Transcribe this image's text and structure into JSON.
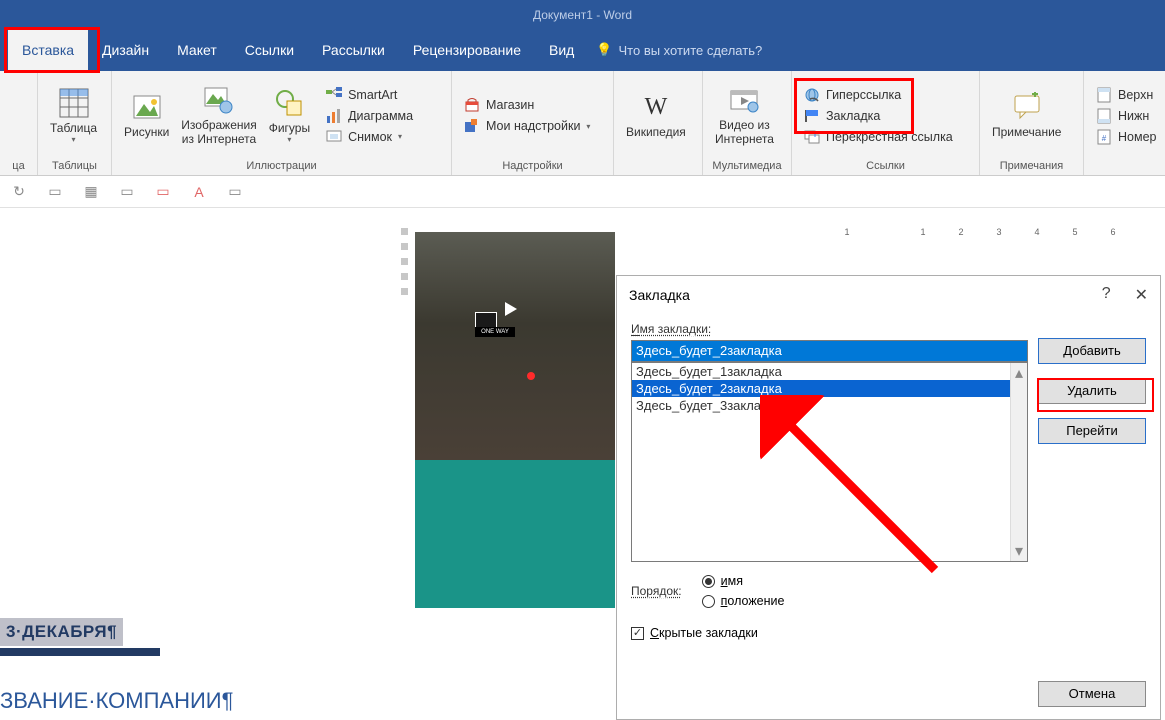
{
  "window": {
    "title": "Документ1 - Word"
  },
  "tabs": {
    "active": "Вставка",
    "items": [
      "Вставка",
      "Дизайн",
      "Макет",
      "Ссылки",
      "Рассылки",
      "Рецензирование",
      "Вид"
    ],
    "tell_me": "Что вы хотите сделать?"
  },
  "ribbon": {
    "groups": {
      "pages": {
        "label": "ца"
      },
      "tables": {
        "label": "Таблицы",
        "table": "Таблица"
      },
      "illustrations": {
        "label": "Иллюстрации",
        "pictures": "Рисунки",
        "online_pictures_l1": "Изображения",
        "online_pictures_l2": "из Интернета",
        "shapes": "Фигуры",
        "smartart": "SmartArt",
        "chart": "Диаграмма",
        "screenshot": "Снимок"
      },
      "addins": {
        "label": "Надстройки",
        "store": "Магазин",
        "my_addins": "Мои надстройки"
      },
      "wiki": {
        "wikipedia": "Википедия"
      },
      "media": {
        "label": "Мультимедиа",
        "online_video_l1": "Видео из",
        "online_video_l2": "Интернета"
      },
      "links": {
        "label": "Ссылки",
        "hyperlink": "Гиперссылка",
        "bookmark": "Закладка",
        "crossref": "Перекрестная ссылка"
      },
      "comments": {
        "label": "Примечания",
        "comment": "Примечание"
      },
      "header_footer": {
        "header": "Верхн",
        "footer": "Нижн",
        "page_number": "Номер"
      }
    }
  },
  "ruler": {
    "marks": [
      "1",
      "",
      "1",
      "2",
      "3",
      "4",
      "5",
      "6"
    ]
  },
  "document": {
    "date_line": "3·ДЕКАБРЯ¶",
    "company_line": "ЗВАНИЕ·КОМПАНИИ¶"
  },
  "dialog": {
    "title": "Закладка",
    "help": "?",
    "close": "✕",
    "name_label": "Имя закладки:",
    "name_value": "Здесь_будет_2закладка",
    "items": [
      "Здесь_будет_1закладка",
      "Здесь_будет_2закладка",
      "Здесь_будет_3закладка"
    ],
    "selected_index": 1,
    "btn_add": "Добавить",
    "btn_delete": "Удалить",
    "btn_goto": "Перейти",
    "order_label": "Порядок:",
    "order_name": "имя",
    "order_location": "положение",
    "order_value": "name",
    "hidden_label": "Скрытые закладки",
    "hidden_checked": true,
    "btn_cancel": "Отмена"
  }
}
